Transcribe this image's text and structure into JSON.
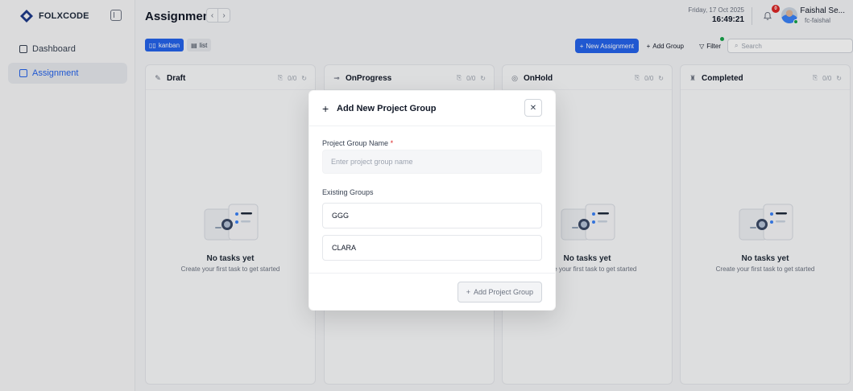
{
  "brand": {
    "name": "FOLXCODE"
  },
  "sidebar": {
    "items": [
      {
        "label": "Dashboard",
        "icon": "home-icon",
        "active": false
      },
      {
        "label": "Assignment",
        "icon": "assignment-icon",
        "active": true
      }
    ]
  },
  "header": {
    "title": "Assignment",
    "date": "Friday, 17 Oct 2025",
    "time": "16:49:21",
    "notifications": "0",
    "user_name": "Faishal Se...",
    "user_handle": "fc-faishal"
  },
  "toolbar": {
    "views": [
      {
        "label": "kanban",
        "active": true
      },
      {
        "label": "list",
        "active": false
      }
    ],
    "new_assignment": "New Assignment",
    "add_group": "Add Group",
    "filter": "Filter",
    "search_placeholder": "Search"
  },
  "board": {
    "columns": [
      {
        "title": "Draft",
        "count": "0/0",
        "icon": "pencil-icon"
      },
      {
        "title": "OnProgress",
        "count": "0/0",
        "icon": "progress-icon"
      },
      {
        "title": "OnHold",
        "count": "0/0",
        "icon": "pause-icon"
      },
      {
        "title": "Completed",
        "count": "0/0",
        "icon": "trophy-icon"
      }
    ],
    "empty_title": "No tasks yet",
    "empty_subtitle": "Create your first task to get started"
  },
  "modal": {
    "title": "Add New Project Group",
    "name_label": "Project Group Name",
    "name_required_mark": "*",
    "name_placeholder": "Enter project group name",
    "existing_label": "Existing Groups",
    "existing_groups": [
      "GGG",
      "CLARA"
    ],
    "submit_label": "Add Project Group"
  },
  "colors": {
    "accent": "#2563eb",
    "danger": "#dc2626",
    "online": "#16a34a"
  }
}
